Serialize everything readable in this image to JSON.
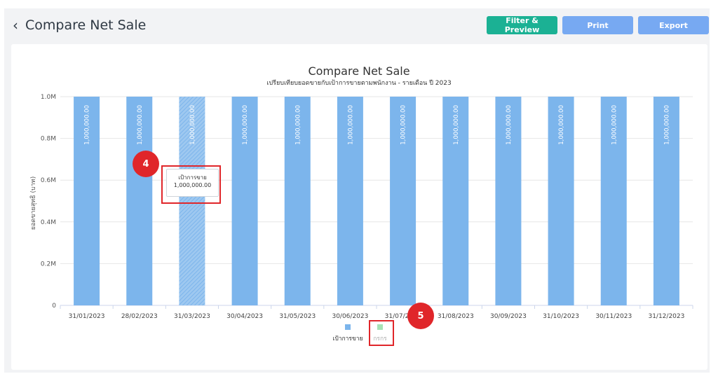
{
  "header": {
    "back_icon": "chevron-left-icon",
    "title": "Compare Net Sale",
    "buttons": {
      "filter": "Filter & Preview",
      "print": "Print",
      "export": "Export"
    }
  },
  "colors": {
    "bar": "#7cb5ec",
    "legend_green": "#a6e3b5",
    "accent_green": "#1bb194",
    "accent_blue": "#77a9f2",
    "annotation_red": "#e0262a"
  },
  "chart_data": {
    "type": "bar",
    "title": "Compare Net Sale",
    "subtitle": "เปรียบเทียบยอดขายกับเป้าการขายตามพนักงาน - รายเดือน ปี 2023",
    "ylabel": "ยอดขายสุทธิ (บาท)",
    "xlabel": "",
    "ylim": [
      0,
      1000000
    ],
    "yticks": [
      "0",
      "0.2M",
      "0.4M",
      "0.6M",
      "0.8M",
      "1.0M"
    ],
    "categories": [
      "31/01/2023",
      "28/02/2023",
      "31/03/2023",
      "30/04/2023",
      "31/05/2023",
      "30/06/2023",
      "31/07/2023",
      "31/08/2023",
      "30/09/2023",
      "31/10/2023",
      "30/11/2023",
      "31/12/2023"
    ],
    "series": [
      {
        "name": "เป้าการขาย",
        "values": [
          1000000,
          1000000,
          1000000,
          1000000,
          1000000,
          1000000,
          1000000,
          1000000,
          1000000,
          1000000,
          1000000,
          1000000
        ],
        "labels": [
          "1,000,000.00",
          "1,000,000.00",
          "1,000,000.00",
          "1,000,000.00",
          "1,000,000.00",
          "1,000,000.00",
          "1,000,000.00",
          "1,000,000.00",
          "1,000,000.00",
          "1,000,000.00",
          "1,000,000.00",
          "1,000,000.00"
        ]
      },
      {
        "name": "กรกร",
        "values": []
      }
    ],
    "hovered_index": 2,
    "grid": true,
    "legend_position": "bottom-center"
  },
  "tooltip": {
    "series": "เป้าการขาย",
    "value": "1,000,000.00"
  },
  "annotations": {
    "marker_4": "4",
    "marker_5": "5"
  }
}
